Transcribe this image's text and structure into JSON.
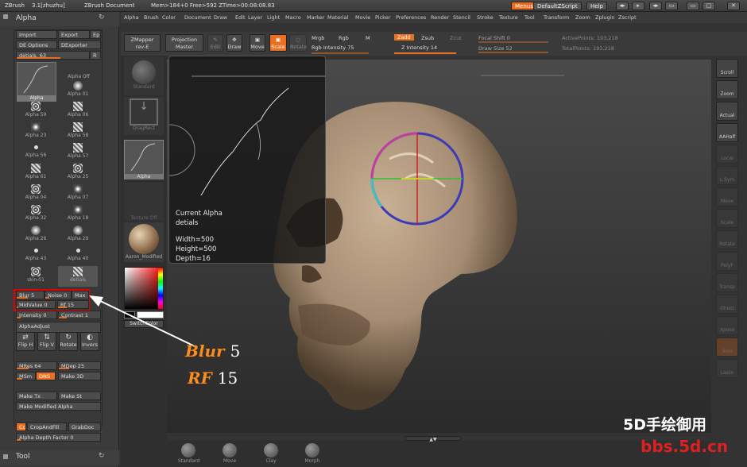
{
  "titlebar": {
    "app": "ZBrush",
    "version": "3.1[zhuzhu]",
    "document": "ZBrush Document",
    "mem": "Mem>184+0 Free>592 ZTime>00:08:08.83",
    "menus_btn": "Menus",
    "defaultzscript_btn": "DefaultZScript",
    "help_btn": "Help"
  },
  "menubar": [
    "Alpha",
    "Brush",
    "Color",
    "Document",
    "Draw",
    "Edit",
    "Layer",
    "Light",
    "Macro",
    "Marker",
    "Material",
    "Movie",
    "Picker",
    "Preferences",
    "Render",
    "Stencil",
    "Stroke",
    "Texture",
    "Tool",
    "Transform",
    "Zoom",
    "Zplugin",
    "Zscript"
  ],
  "left": {
    "alpha_title": "Alpha",
    "import": "Import",
    "export": "Export",
    "ep": "Ep",
    "de_options": "DE Options",
    "dexporter": "DExporter",
    "detials": "detials. 63",
    "r": "R",
    "current_alpha_label": "Alpha",
    "alpha_off": "Alpha Off",
    "alphas": [
      "Alpha 01",
      "Alpha 59",
      "Alpha 06",
      "Alpha 23",
      "Alpha 58",
      "Alpha 56",
      "Alpha 57",
      "Alpha 61",
      "Alpha 25",
      "Alpha 04",
      "Alpha 07",
      "Alpha 32",
      "Alpha 18",
      "Alpha 26",
      "Alpha 29",
      "Alpha 43",
      "Alpha 40",
      "skin-01",
      "detials"
    ],
    "blur": "Blur 5",
    "noise": "Noise 0",
    "max": "Max",
    "midvalue": "MidValue 0",
    "rf": "Rf 15",
    "intensity": "Intensity 0",
    "contrast": "Contrast 1",
    "alphaadjust": "AlphaAdjust",
    "flip_h": "Flip H",
    "flip_v": "Flip V",
    "rotate": "Rotate",
    "invers": "Invers",
    "mres": "MRes 64",
    "mdep": "MDep 25",
    "msm": "MSm",
    "dns": "DNS",
    "make3d": "Make 3D",
    "maketx": "Make Tx",
    "makest": "Make St",
    "make_modified": "Make Modified Alpha",
    "cc": "Cc",
    "cropandfill": "CropAndFill",
    "grabdoc": "GrabDoc",
    "alpha_depth": "Alpha Depth Factor 0",
    "tool_title": "Tool"
  },
  "shelf": {
    "zmapper": "ZMapper",
    "rev_e": "rev-E",
    "projection": "Projection",
    "master": "Master",
    "edit": "Edit",
    "draw": "Draw",
    "move": "Move",
    "scale": "Scale",
    "rotate": "Rotate",
    "mrgb": "Mrgb",
    "rgb": "Rgb",
    "m": "M",
    "rgb_intensity": "Rgb Intensity 75",
    "zadd": "Zadd",
    "zsub": "Zsub",
    "zcut": "Zcut",
    "z_intensity": "Z Intensity 14",
    "focal_shift": "Focal Shift 0",
    "draw_size": "Draw Size 52",
    "active_points": "ActivePoints: 193,218",
    "total_points": "TotalPoints: 193,218"
  },
  "toolstrip": {
    "standard": "Standard",
    "dragrect": "DragRect",
    "alpha": "Alpha",
    "texture_off": "Texture Off",
    "material": "Aaron_Modified",
    "switchcolor": "SwitchColor"
  },
  "popup": {
    "title": "Current Alpha",
    "name": "detials",
    "width": "Width=500",
    "height": "Height=500",
    "depth": "Depth=16"
  },
  "right": [
    "Scroll",
    "Zoom",
    "Actual",
    "AAHalf",
    "Local",
    "L.Sym",
    "Move",
    "Scale",
    "Rotate",
    "PolyF",
    "Transp",
    "Ghost",
    "Xpose",
    "Solo",
    "Lasso"
  ],
  "bottom": [
    "Standard",
    "Move",
    "Clay",
    "Morph"
  ],
  "annotation": {
    "blur_label": "Blur",
    "blur_value": "5",
    "rf_label": "RF",
    "rf_value": "15"
  },
  "watermark": {
    "line1": "5D手绘御用",
    "line2": "bbs.5d.cn"
  },
  "colors": {
    "accent": "#e87020",
    "highlight_box": "#e00000"
  }
}
